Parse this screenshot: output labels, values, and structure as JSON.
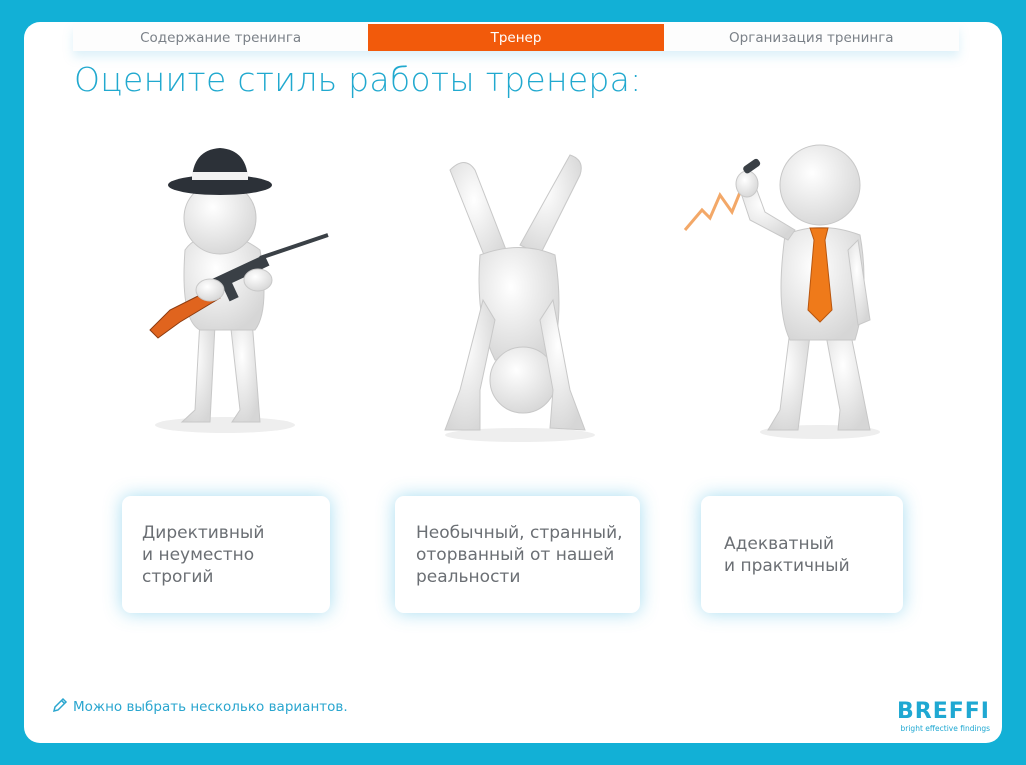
{
  "nav": {
    "steps": [
      {
        "label": "Содержание тренинга",
        "active": false
      },
      {
        "label": "Тренер",
        "active": true
      },
      {
        "label": "Организация тренинга",
        "active": false
      }
    ]
  },
  "page_title": "Оцените стиль работы тренера:",
  "options": [
    {
      "label": "Директивный\nи неуместно\nстрогий",
      "figure": "gangster-figure-with-gun"
    },
    {
      "label": "Необычный, странный,\nоторванный от нашей\nреальности",
      "figure": "handstand-figure"
    },
    {
      "label": "Адекватный\nи практичный",
      "figure": "businessman-figure-with-tie"
    }
  ],
  "hint": {
    "text": "Можно выбрать несколько вариантов.",
    "icon": "pencil-icon"
  },
  "logo": {
    "brand": "BREFFI",
    "tagline": "bright effective findings"
  },
  "colors": {
    "frame": "#12b0d6",
    "accent": "#f25a0b",
    "title": "#21a9cf"
  }
}
